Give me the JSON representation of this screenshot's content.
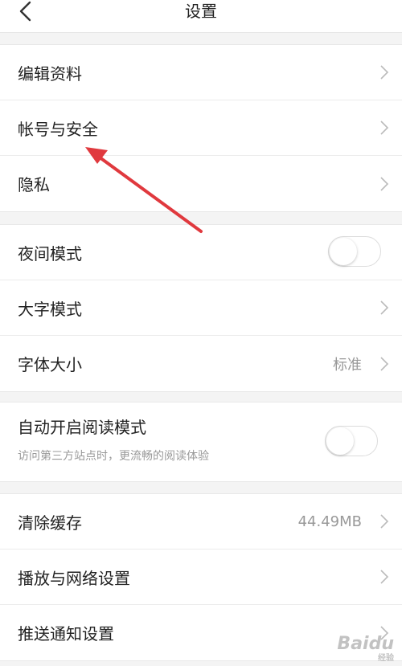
{
  "header": {
    "title": "设置",
    "back_icon": "chevron-left-icon"
  },
  "groups": [
    {
      "items": [
        {
          "label": "编辑资料",
          "control": "chevron"
        },
        {
          "label": "帐号与安全",
          "control": "chevron"
        },
        {
          "label": "隐私",
          "control": "chevron"
        }
      ]
    },
    {
      "items": [
        {
          "label": "夜间模式",
          "control": "toggle",
          "enabled": false
        },
        {
          "label": "大字模式",
          "control": "chevron"
        },
        {
          "label": "字体大小",
          "control": "chevron",
          "value": "标准"
        }
      ]
    },
    {
      "items": [
        {
          "label": "自动开启阅读模式",
          "sublabel": "访问第三方站点时，更流畅的阅读体验",
          "control": "toggle",
          "enabled": false
        }
      ]
    },
    {
      "items": [
        {
          "label": "清除缓存",
          "control": "chevron",
          "value": "44.49MB"
        },
        {
          "label": "播放与网络设置",
          "control": "chevron"
        },
        {
          "label": "推送通知设置",
          "control": "chevron"
        }
      ]
    }
  ],
  "annotation_arrow": {
    "color": "#e0393e",
    "points_to": "帐号与安全"
  },
  "watermark": {
    "text": "Baidu",
    "sub": "经验"
  }
}
